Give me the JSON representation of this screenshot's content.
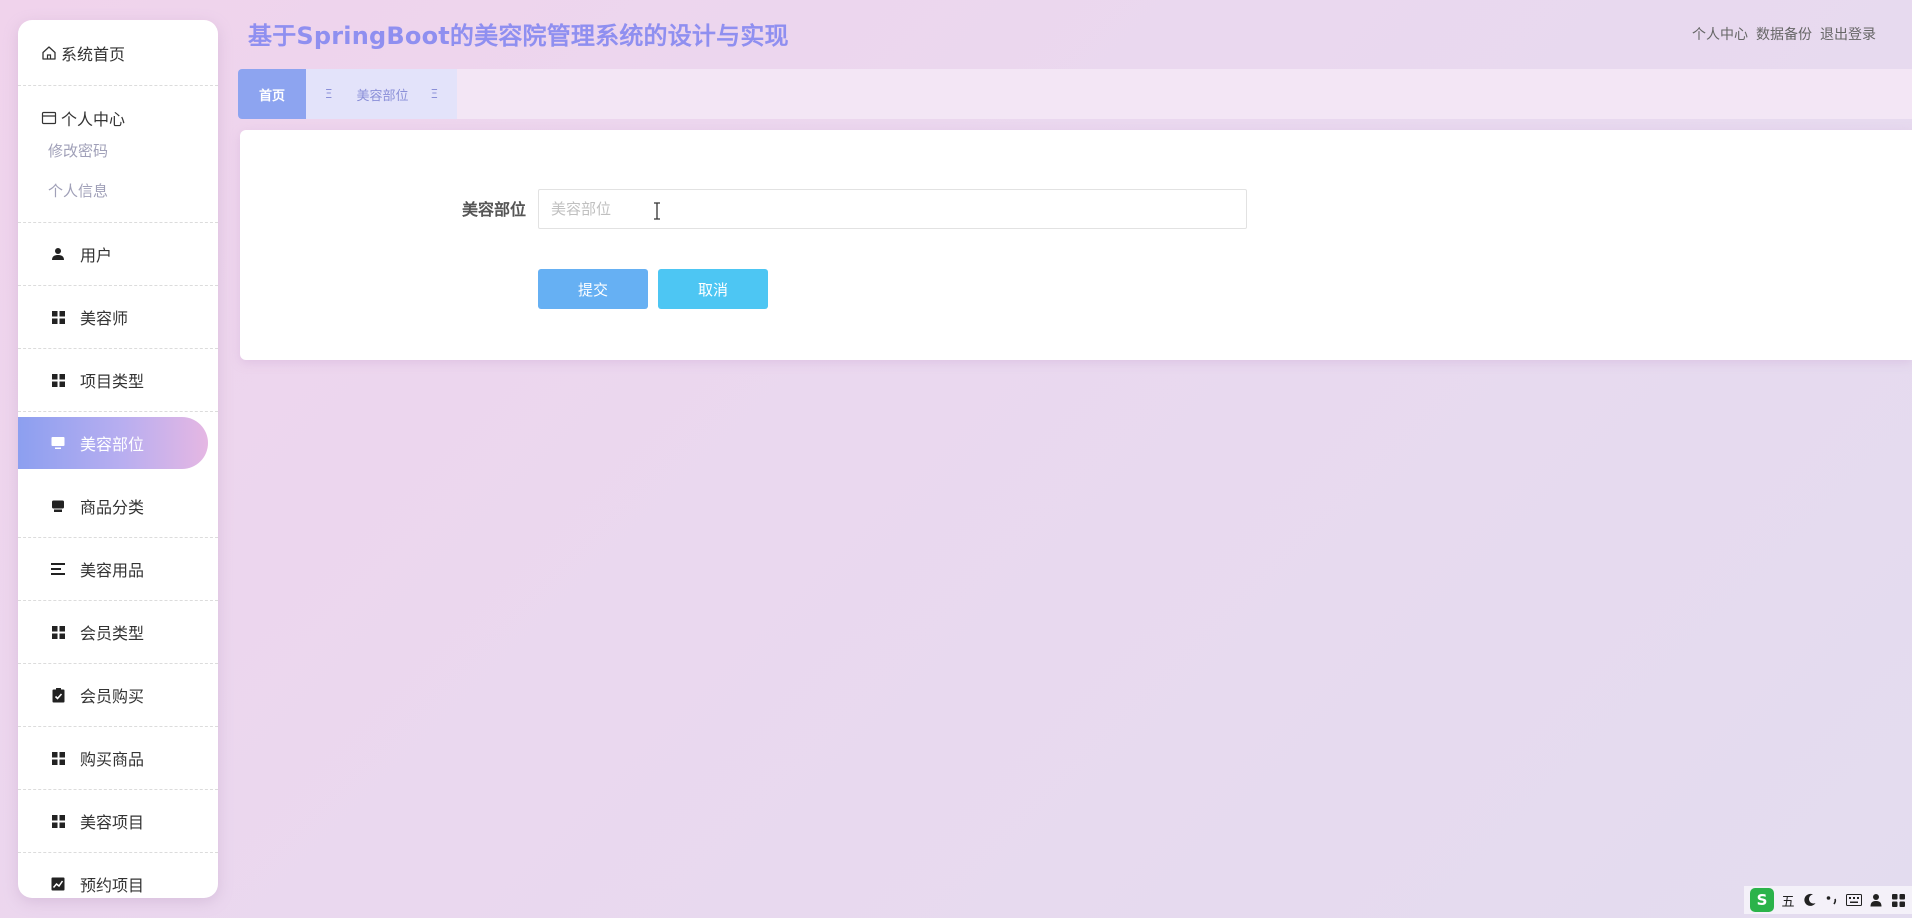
{
  "app": {
    "title": "基于SpringBoot的美容院管理系统的设计与实现"
  },
  "header": {
    "links": [
      "个人中心",
      "数据备份",
      "退出登录"
    ]
  },
  "sidebar": {
    "home": "系统首页",
    "personal": {
      "title": "个人中心",
      "subs": [
        "修改密码",
        "个人信息"
      ]
    },
    "items": [
      {
        "label": "用户",
        "icon": "user-icon"
      },
      {
        "label": "美容师",
        "icon": "grid-icon"
      },
      {
        "label": "项目类型",
        "icon": "grid-icon"
      },
      {
        "label": "美容部位",
        "icon": "monitor-icon",
        "active": true
      },
      {
        "label": "商品分类",
        "icon": "box-icon"
      },
      {
        "label": "美容用品",
        "icon": "list-icon"
      },
      {
        "label": "会员类型",
        "icon": "grid-icon"
      },
      {
        "label": "会员购买",
        "icon": "clipboard-check-icon"
      },
      {
        "label": "购买商品",
        "icon": "grid-icon"
      },
      {
        "label": "美容项目",
        "icon": "grid-icon"
      },
      {
        "label": "预约项目",
        "icon": "chart-icon"
      }
    ]
  },
  "tabs": [
    {
      "label": "首页",
      "active": true
    },
    {
      "label": "美容部位",
      "left_glyph": "Ξ",
      "right_glyph": "Ξ"
    }
  ],
  "form": {
    "label": "美容部位",
    "placeholder": "美容部位",
    "value": "",
    "submit": "提交",
    "cancel": "取消"
  },
  "tray": {
    "ime": "五",
    "logo": "S"
  },
  "colors": {
    "accent": "#8da4f0",
    "title": "#8f8ff0",
    "submit": "#66b0f3",
    "cancel": "#4dc6f3"
  }
}
